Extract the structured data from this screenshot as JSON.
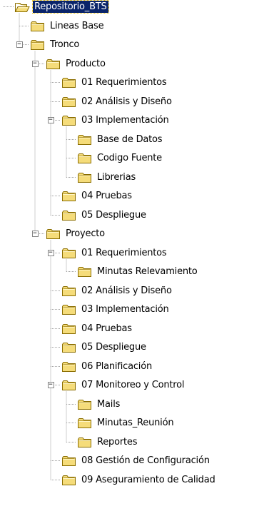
{
  "colors": {
    "folder_fill": "#f5dc7a",
    "folder_dark": "#8a6d00",
    "selected_bg": "#0a246a",
    "selected_text": "#ffffff",
    "tree_line": "#a0a0a0"
  },
  "tree": [
    {
      "label": "Repositorio_BTS",
      "level": 0,
      "icon": "folder-open-icon",
      "selected": true,
      "expander": ""
    },
    {
      "label": "Lineas Base",
      "level": 1,
      "icon": "folder-icon",
      "expander": ""
    },
    {
      "label": "Tronco",
      "level": 1,
      "icon": "folder-icon",
      "expander": "collapse"
    },
    {
      "label": "Producto",
      "level": 2,
      "icon": "folder-icon",
      "expander": "collapse"
    },
    {
      "label": "01 Requerimientos",
      "level": 3,
      "icon": "folder-icon",
      "expander": ""
    },
    {
      "label": "02 Análisis y Diseño",
      "level": 3,
      "icon": "folder-icon",
      "expander": ""
    },
    {
      "label": "03 Implementación",
      "level": 3,
      "icon": "folder-icon",
      "expander": "collapse"
    },
    {
      "label": "Base de Datos",
      "level": 4,
      "icon": "folder-icon",
      "expander": ""
    },
    {
      "label": "Codigo Fuente",
      "level": 4,
      "icon": "folder-icon",
      "expander": ""
    },
    {
      "label": "Librerias",
      "level": 4,
      "icon": "folder-icon",
      "expander": ""
    },
    {
      "label": "04 Pruebas",
      "level": 3,
      "icon": "folder-icon",
      "expander": ""
    },
    {
      "label": "05 Despliegue",
      "level": 3,
      "icon": "folder-icon",
      "expander": ""
    },
    {
      "label": "Proyecto",
      "level": 2,
      "icon": "folder-icon",
      "expander": "collapse"
    },
    {
      "label": "01 Requerimientos",
      "level": 3,
      "icon": "folder-icon",
      "expander": "collapse"
    },
    {
      "label": "Minutas Relevamiento",
      "level": 4,
      "icon": "folder-icon",
      "expander": ""
    },
    {
      "label": "02 Análisis y Diseño",
      "level": 3,
      "icon": "folder-icon",
      "expander": ""
    },
    {
      "label": "03 Implementación",
      "level": 3,
      "icon": "folder-icon",
      "expander": ""
    },
    {
      "label": "04 Pruebas",
      "level": 3,
      "icon": "folder-icon",
      "expander": ""
    },
    {
      "label": "05 Despliegue",
      "level": 3,
      "icon": "folder-icon",
      "expander": ""
    },
    {
      "label": "06 Planificación",
      "level": 3,
      "icon": "folder-icon",
      "expander": ""
    },
    {
      "label": "07 Monitoreo y Control",
      "level": 3,
      "icon": "folder-icon",
      "expander": "collapse"
    },
    {
      "label": "Mails",
      "level": 4,
      "icon": "folder-icon",
      "expander": ""
    },
    {
      "label": "Minutas_Reunión",
      "level": 4,
      "icon": "folder-icon",
      "expander": ""
    },
    {
      "label": "Reportes",
      "level": 4,
      "icon": "folder-icon",
      "expander": ""
    },
    {
      "label": "08 Gestión de Configuración",
      "level": 3,
      "icon": "folder-icon",
      "expander": ""
    },
    {
      "label": "09 Aseguramiento de Calidad",
      "level": 3,
      "icon": "folder-icon",
      "expander": ""
    }
  ]
}
